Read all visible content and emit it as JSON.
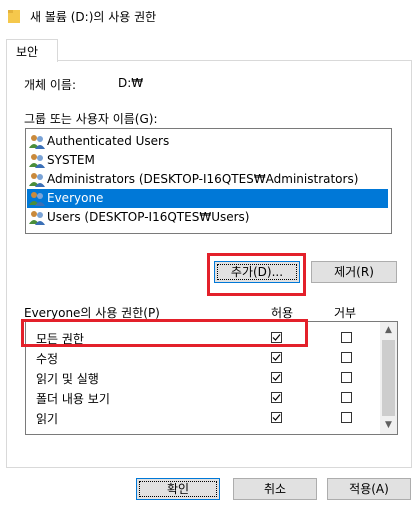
{
  "window": {
    "title": "새 볼륨 (D:)의 사용 권한"
  },
  "tabs": {
    "security": "보안"
  },
  "object": {
    "label": "개체 이름:",
    "value": "D:₩"
  },
  "groups": {
    "label": "그룹 또는 사용자 이름(G):",
    "items": [
      {
        "label": "Authenticated Users",
        "icon": "users-icon"
      },
      {
        "label": "SYSTEM",
        "icon": "users-icon"
      },
      {
        "label": "Administrators (DESKTOP-I16QTES₩Administrators)",
        "icon": "users-icon"
      },
      {
        "label": "Everyone",
        "icon": "users-icon",
        "selected": true
      },
      {
        "label": "Users (DESKTOP-I16QTES₩Users)",
        "icon": "users-icon"
      }
    ]
  },
  "buttons": {
    "add": "추가(D)...",
    "remove": "제거(R)",
    "ok": "확인",
    "cancel": "취소",
    "apply": "적용(A)"
  },
  "permissions": {
    "label": "Everyone의 사용 권한(P)",
    "allow_header": "허용",
    "deny_header": "거부",
    "rows": [
      {
        "name": "모든 권한",
        "allow": true,
        "deny": false
      },
      {
        "name": "수정",
        "allow": true,
        "deny": false
      },
      {
        "name": "읽기 및 실행",
        "allow": true,
        "deny": false
      },
      {
        "name": "폴더 내용 보기",
        "allow": true,
        "deny": false
      },
      {
        "name": "읽기",
        "allow": true,
        "deny": false
      }
    ]
  },
  "colors": {
    "selection": "#0078d7",
    "highlight_box": "#e3202a",
    "folder": "#f5c84c"
  }
}
